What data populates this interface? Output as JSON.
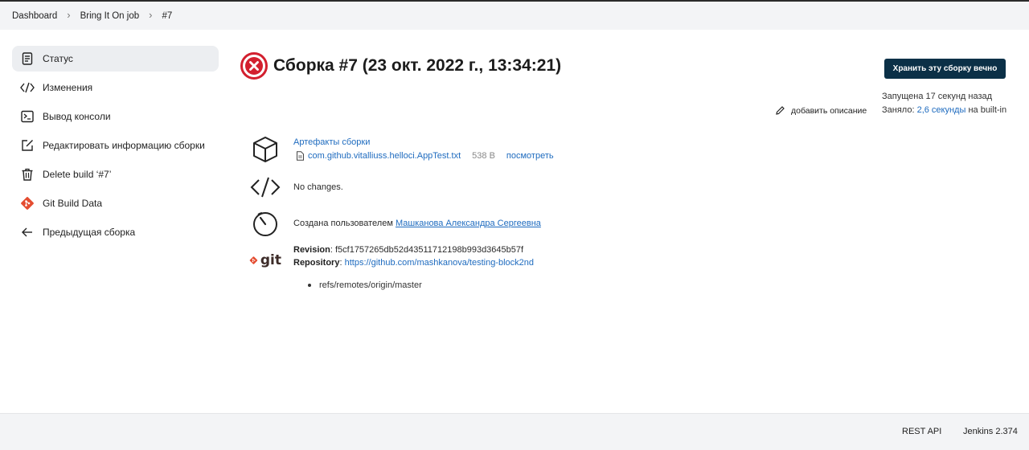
{
  "breadcrumb": [
    "Dashboard",
    "Bring It On job",
    "#7"
  ],
  "sidebar": {
    "items": [
      {
        "label": "Статус",
        "icon": "document-icon",
        "active": true
      },
      {
        "label": "Изменения",
        "icon": "code-icon"
      },
      {
        "label": "Вывод консоли",
        "icon": "terminal-icon"
      },
      {
        "label": "Редактировать информацию сборки",
        "icon": "edit-icon"
      },
      {
        "label": "Delete build ‘#7’",
        "icon": "trash-icon"
      },
      {
        "label": "Git Build Data",
        "icon": "git-icon"
      },
      {
        "label": "Предыдущая сборка",
        "icon": "arrow-left-icon"
      }
    ]
  },
  "header": {
    "title": "Сборка #7 (23 окт. 2022 г., 13:34:21)",
    "status": "failed",
    "status_color": "#d3202f",
    "keep_button": "Хранить эту сборку вечно",
    "started": "Запущена 17 секунд назад",
    "took_prefix": "Заняло: ",
    "took_value": "2,6 секунды",
    "took_suffix": " на built-in",
    "add_description": "добавить описание"
  },
  "artifacts": {
    "title": "Артефакты сборки",
    "file": "com.github.vitalliuss.helloci.AppTest.txt",
    "size": "538 B",
    "view": "посмотреть"
  },
  "changes": {
    "text": "No changes."
  },
  "started_by": {
    "prefix": "Создана пользователем ",
    "user": "Машканова Александра Сергеевна"
  },
  "git": {
    "logo_text": "git",
    "revision_label": "Revision",
    "revision": ": f5cf1757265db52d43511712198b993d3645b57f",
    "repository_label": "Repository",
    "repository_sep": ": ",
    "repository": "https://github.com/mashkanova/testing-block2nd",
    "branch": "refs/remotes/origin/master"
  },
  "footer": {
    "rest_api": "REST API",
    "version": "Jenkins 2.374"
  },
  "colors": {
    "link": "#1e6bbf",
    "button": "#0b3047",
    "bar": "#f3f4f6",
    "git": "#e44c30"
  }
}
